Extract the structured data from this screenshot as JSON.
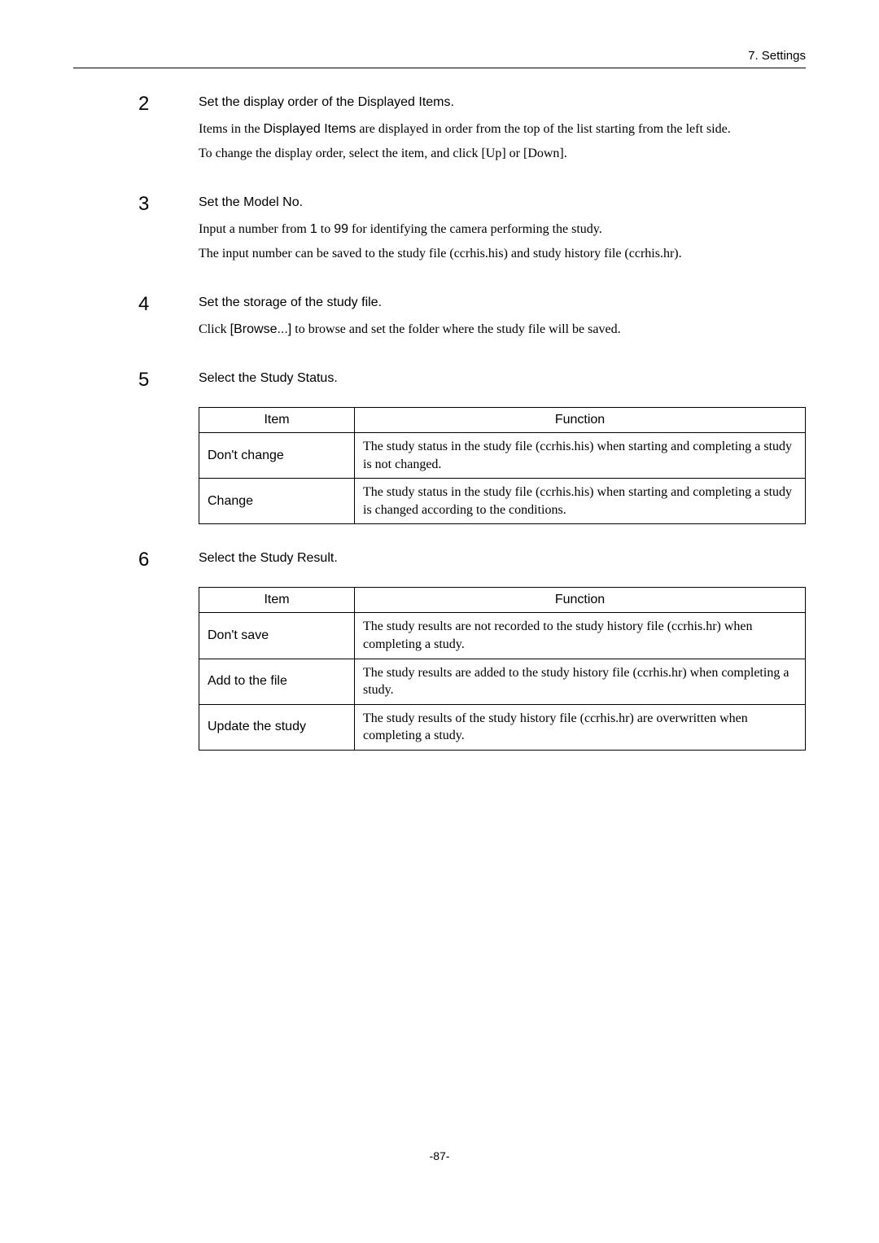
{
  "header": {
    "chapter": "7. Settings"
  },
  "steps": [
    {
      "num": "2",
      "title_parts": [
        "Set the display order of the ",
        "Displayed Items",
        "."
      ],
      "paragraphs": [
        {
          "segments": [
            {
              "t": "Items in the "
            },
            {
              "t": "Displayed Items",
              "sans": true
            },
            {
              "t": " are displayed in order from the top of the list starting from the left side."
            }
          ]
        },
        {
          "segments": [
            {
              "t": "To change the display order, select the item, and click [Up] or [Down]."
            }
          ]
        }
      ]
    },
    {
      "num": "3",
      "title_parts": [
        "Set the ",
        "Model No."
      ],
      "paragraphs": [
        {
          "segments": [
            {
              "t": "Input a number from "
            },
            {
              "t": "1",
              "sans": true
            },
            {
              "t": " to "
            },
            {
              "t": "99",
              "sans": true
            },
            {
              "t": " for identifying the camera performing the study."
            }
          ]
        },
        {
          "segments": [
            {
              "t": "The input number can be saved to the study file (ccrhis.his) and study history file (ccrhis.hr)."
            }
          ]
        }
      ]
    },
    {
      "num": "4",
      "title_parts": [
        "Set the storage of the study file."
      ],
      "paragraphs": [
        {
          "segments": [
            {
              "t": "Click "
            },
            {
              "t": "[Browse...]",
              "sans": true
            },
            {
              "t": " to browse and set the folder where the study file will be saved."
            }
          ]
        }
      ]
    },
    {
      "num": "5",
      "title_parts": [
        "Select the ",
        "Study Status",
        "."
      ],
      "table": {
        "headers": [
          "Item",
          "Function"
        ],
        "rows": [
          {
            "item": "Don't change",
            "func": "The study status in the study file (ccrhis.his) when starting and completing a study is not changed."
          },
          {
            "item": "Change",
            "func": "The study status in the study file (ccrhis.his) when starting and completing a study is changed according to the conditions."
          }
        ]
      }
    },
    {
      "num": "6",
      "title_parts": [
        "Select the ",
        "Study Result",
        "."
      ],
      "table": {
        "headers": [
          "Item",
          "Function"
        ],
        "rows": [
          {
            "item": "Don't save",
            "func": "The study results are not recorded to the study history file (ccrhis.hr) when completing a study."
          },
          {
            "item": "Add to the file",
            "func": "The study results are added to the study history file (ccrhis.hr) when completing a study."
          },
          {
            "item": "Update the study",
            "func": "The study results of the study history file (ccrhis.hr) are overwritten when completing a study."
          }
        ]
      }
    }
  ],
  "page_number": "-87-"
}
